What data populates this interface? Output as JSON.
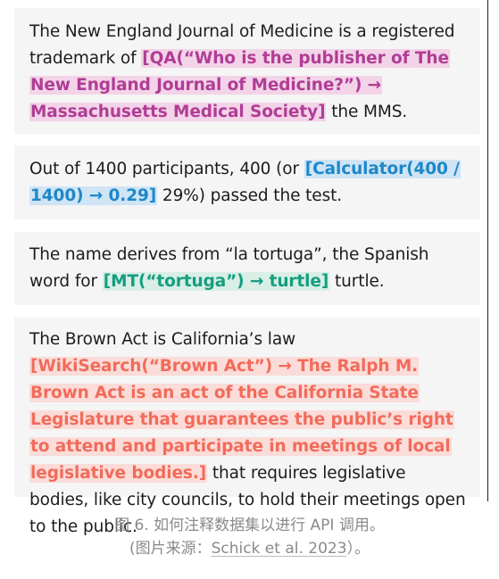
{
  "examples": [
    {
      "before": "The New England Journal of Medicine is a registered trademark of ",
      "call": "[QA(“Who is the publisher of The New England Journal of Medicine?”) → Massachusetts Medical Society]",
      "after": " the MMS.",
      "tool": "QA",
      "color": "#b03d95"
    },
    {
      "before": "Out of 1400 participants, 400 (or ",
      "call": "[Calculator(400 / 1400) → 0.29]",
      "after": " 29%) passed the test.",
      "tool": "Calculator",
      "color": "#1e88c8"
    },
    {
      "before": "The name derives from “la tortuga”, the Spanish word for ",
      "call": "[MT(“tortuga”) → turtle]",
      "after": " turtle.",
      "tool": "MT",
      "color": "#159e80"
    },
    {
      "before": "The Brown Act is California’s law ",
      "call": "[WikiSearch(“Brown Act”) → The Ralph M. Brown Act is an act of the California State Legislature that guarantees the public’s right to attend and participate in meetings of local legislative bodies.]",
      "after": " that requires legislative bodies, like city councils, to hold their meetings open to the public.",
      "tool": "WikiSearch",
      "color": "#f26b5b"
    }
  ],
  "caption": {
    "line1": "图 6. 如何注释数据集以进行 API 调用。",
    "line2_prefix": "(图片来源：",
    "citation": "Schick et al. 2023",
    "line2_suffix": "）。"
  }
}
